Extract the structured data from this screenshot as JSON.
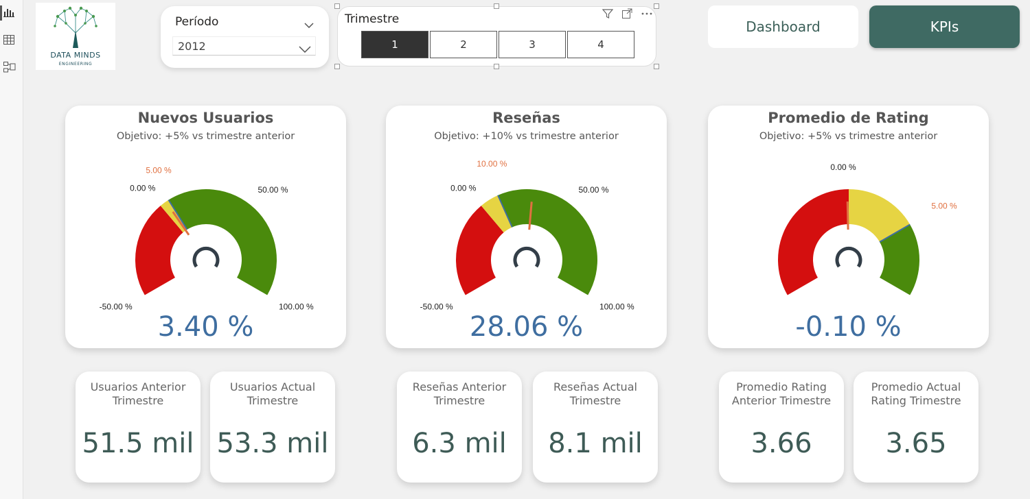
{
  "logo": {
    "line1": "DATA MINDS",
    "line2": "ENGINEERING"
  },
  "rail": {
    "icons": [
      "report-view-icon",
      "table-view-icon",
      "model-view-icon"
    ]
  },
  "periodo": {
    "title": "Período",
    "value": "2012"
  },
  "trimestre": {
    "title": "Trimestre",
    "options": [
      "1",
      "2",
      "3",
      "4"
    ],
    "selected": "1"
  },
  "nav": {
    "dashboard": "Dashboard",
    "kpis": "KPIs"
  },
  "colors": {
    "red": "#d40f0f",
    "yellow": "#e6d443",
    "green": "#4a8a0c",
    "target": "#e07040",
    "accent": "#3f6a63",
    "value": "#3f6ea0"
  },
  "gauges": [
    {
      "title": "Nuevos Usuarios",
      "subtitle": "Objetivo: +5% vs trimestre anterior",
      "min": -50,
      "max": 100,
      "yellow_start": 0,
      "target": 5,
      "value": 3.4,
      "min_label": "-50.00 %",
      "max_label": "100.00 %",
      "zero_label": "0.00 %",
      "target_label": "5.00 %",
      "fifty_label": "50.00 %",
      "value_label": "3.40 %"
    },
    {
      "title": "Reseñas",
      "subtitle": "Objetivo: +10% vs trimestre anterior",
      "min": -50,
      "max": 100,
      "yellow_start": 0,
      "target": 10,
      "value": 28.06,
      "min_label": "-50.00 %",
      "max_label": "100.00 %",
      "zero_label": "0.00 %",
      "target_label": "10.00 %",
      "fifty_label": "50.00 %",
      "value_label": "28.06 %"
    },
    {
      "title": "Promedio de Rating",
      "subtitle": "Objetivo: +5% vs trimestre anterior",
      "min": -10,
      "max": 10,
      "yellow_start": 0,
      "target": 5,
      "value": -0.1,
      "min_label": "",
      "max_label": "",
      "zero_label": "0.00 %",
      "target_label": "5.00 %",
      "fifty_label": "",
      "value_label": "-0.10 %"
    }
  ],
  "kpis": [
    {
      "label": "Usuarios Anterior Trimestre",
      "value": "51.5 mil"
    },
    {
      "label": "Usuarios Actual Trimestre",
      "value": "53.3 mil"
    },
    {
      "label": "Reseñas Anterior Trimestre",
      "value": "6.3 mil"
    },
    {
      "label": "Reseñas Actual Trimestre",
      "value": "8.1 mil"
    },
    {
      "label": "Promedio Rating Anterior Trimestre",
      "value": "3.66"
    },
    {
      "label": "Promedio Actual Rating Trimestre",
      "value": "3.65"
    }
  ]
}
